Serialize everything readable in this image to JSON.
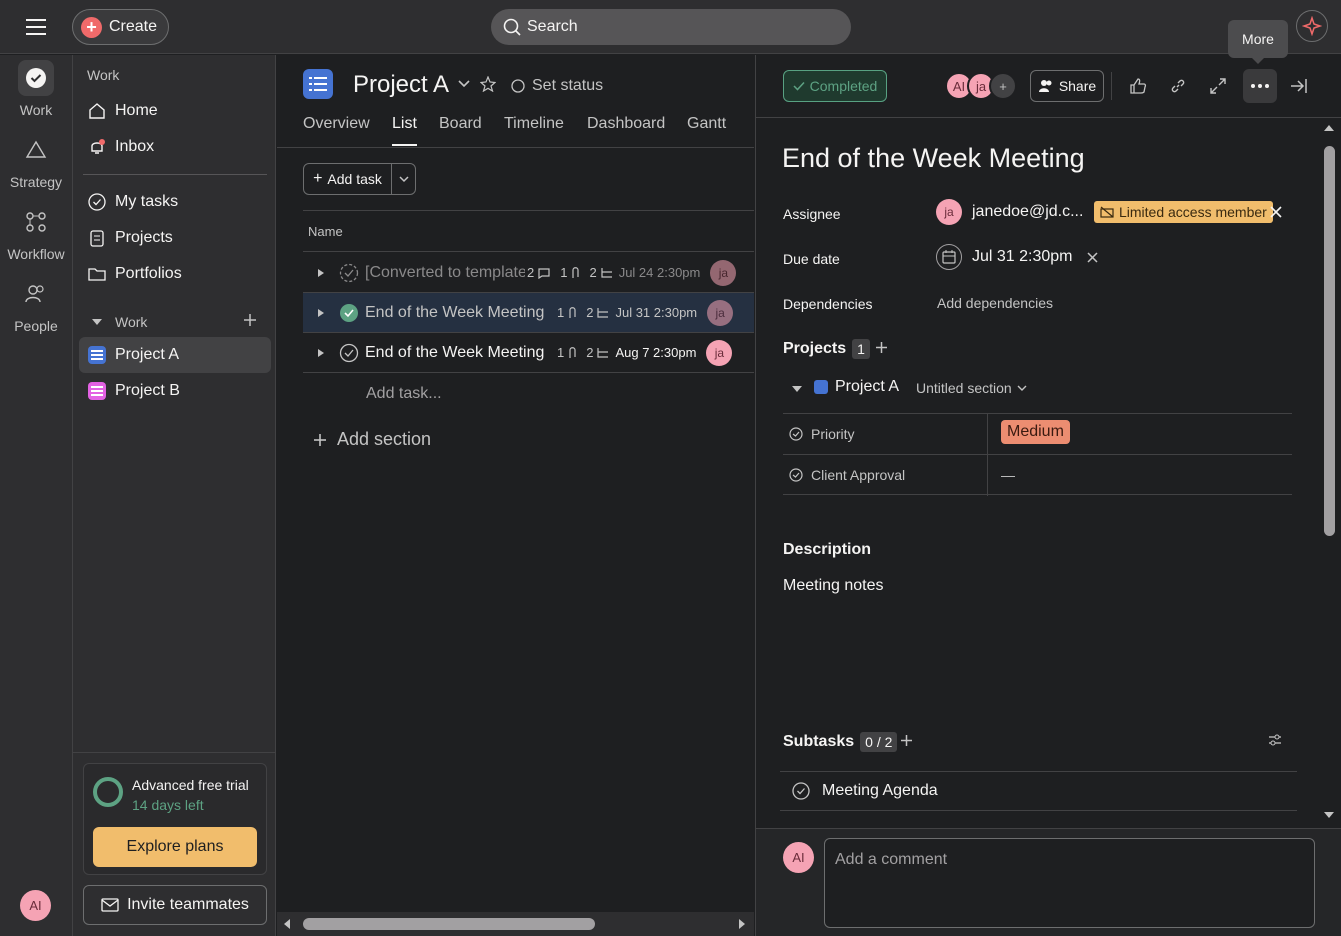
{
  "topbar": {
    "create_label": "Create",
    "search_placeholder": "Search",
    "tooltip": "More"
  },
  "rail": {
    "items": [
      {
        "label": "Work",
        "icon": "check-circle-icon"
      },
      {
        "label": "Strategy",
        "icon": "triangle-icon"
      },
      {
        "label": "Workflow",
        "icon": "workflow-icon"
      },
      {
        "label": "People",
        "icon": "people-icon"
      }
    ],
    "avatar": "AI"
  },
  "sidebar": {
    "section1_label": "Work",
    "home": "Home",
    "inbox": "Inbox",
    "my_tasks": "My tasks",
    "projects": "Projects",
    "portfolios": "Portfolios",
    "section2_label": "Work",
    "project_a": "Project A",
    "project_b": "Project B",
    "trial_title": "Advanced free trial",
    "trial_days": "14 days left",
    "explore": "Explore plans",
    "invite": "Invite teammates"
  },
  "main": {
    "title": "Project A",
    "set_status": "Set status",
    "tabs": [
      "Overview",
      "List",
      "Board",
      "Timeline",
      "Dashboard",
      "Gantt"
    ],
    "add_task": "Add task",
    "name_header": "Name",
    "tasks": [
      {
        "name": "[Converted to template]",
        "comments": "2",
        "attachments": "1",
        "subtasks": "2",
        "date": "Jul 24 2:30pm",
        "avatar": "ja"
      },
      {
        "name": "End of the Week Meeting",
        "attachments": "1",
        "subtasks": "2",
        "date": "Jul 31 2:30pm",
        "avatar": "ja"
      },
      {
        "name": "End of the Week Meeting",
        "attachments": "1",
        "subtasks": "2",
        "date": "Aug 7 2:30pm",
        "avatar": "ja"
      }
    ],
    "add_task_inline": "Add task...",
    "add_section": "Add section"
  },
  "detail": {
    "completed": "Completed",
    "avatars": [
      "AI",
      "ja"
    ],
    "share": "Share",
    "title": "End of the Week Meeting",
    "assignee_label": "Assignee",
    "assignee_avatar": "ja",
    "assignee": "janedoe@jd.c...",
    "limited": "Limited access member",
    "due_label": "Due date",
    "due": "Jul 31 2:30pm",
    "deps_label": "Dependencies",
    "deps": "Add dependencies",
    "projects_label": "Projects",
    "projects_count": "1",
    "project_name": "Project A",
    "section": "Untitled section",
    "priority_label": "Priority",
    "priority": "Medium",
    "approval_label": "Client Approval",
    "approval": "—",
    "desc_label": "Description",
    "desc": "Meeting notes",
    "subtasks_label": "Subtasks",
    "subtasks_count": "0 / 2",
    "subtask1": "Meeting Agenda",
    "comment_avatar": "AI",
    "comment_placeholder": "Add a comment"
  },
  "colors": {
    "accent_red": "#f06a6a",
    "project_a": "#4573d2",
    "project_b": "#e362e3",
    "completed_green": "#5da283",
    "medium_orange": "#ec8d71",
    "limited_yellow": "#f1bd6c"
  }
}
